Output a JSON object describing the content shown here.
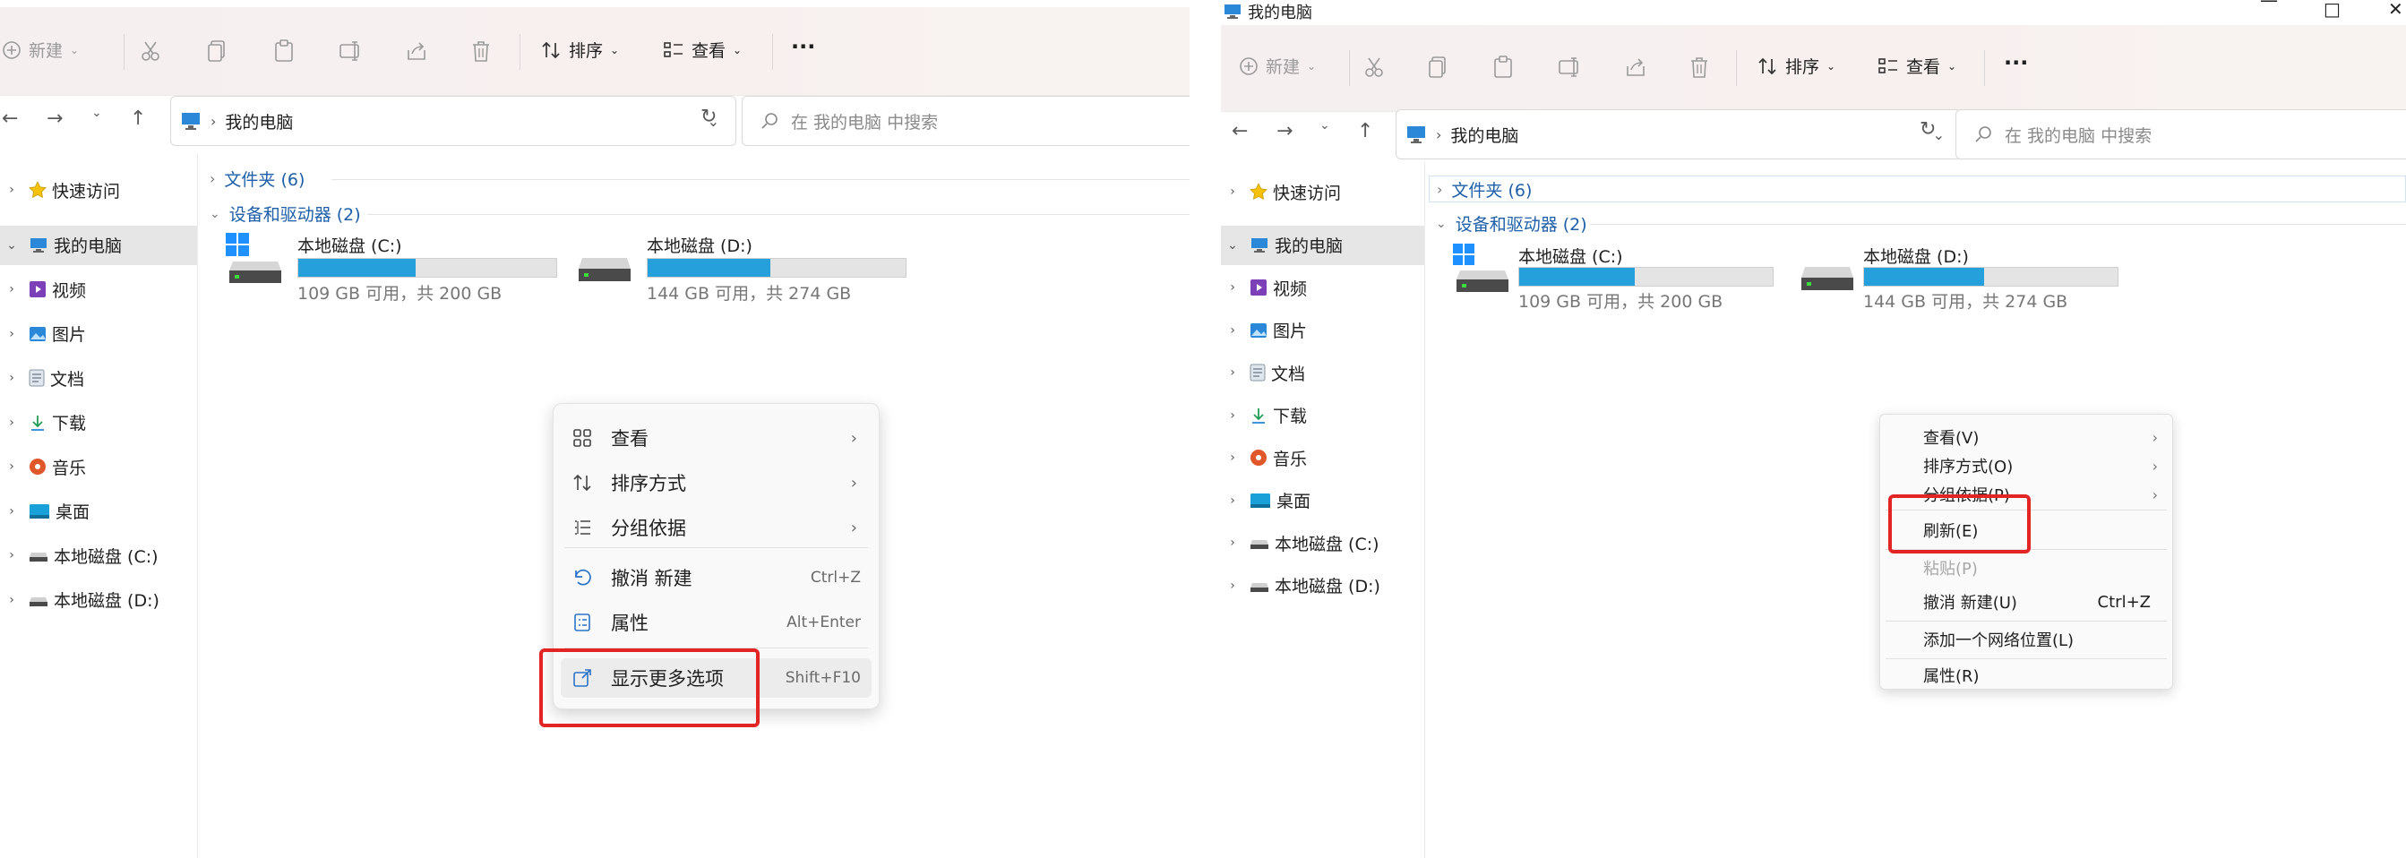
{
  "left": {
    "toolbar": {
      "new_label": "新建",
      "sort_label": "排序",
      "view_label": "查看",
      "more_label": "···"
    },
    "address": {
      "path": "我的电脑",
      "separator": "›"
    },
    "search": {
      "placeholder": "在 我的电脑 中搜索"
    },
    "sidebar": [
      {
        "label": "快速访问",
        "icon": "star-icon"
      },
      {
        "label": "我的电脑",
        "icon": "computer-icon",
        "selected": true
      },
      {
        "label": "视频",
        "icon": "video-icon"
      },
      {
        "label": "图片",
        "icon": "picture-icon"
      },
      {
        "label": "文档",
        "icon": "document-icon"
      },
      {
        "label": "下载",
        "icon": "download-icon"
      },
      {
        "label": "音乐",
        "icon": "music-icon"
      },
      {
        "label": "桌面",
        "icon": "desktop-icon"
      },
      {
        "label": "本地磁盘 (C:)",
        "icon": "drive-icon"
      },
      {
        "label": "本地磁盘 (D:)",
        "icon": "drive-icon"
      }
    ],
    "groups": {
      "folders": "文件夹 (6)",
      "devices": "设备和驱动器 (2)"
    },
    "drives": [
      {
        "name": "本地磁盘 (C:)",
        "free": "109 GB 可用，共 200 GB",
        "used_fraction": 0.455
      },
      {
        "name": "本地磁盘 (D:)",
        "free": "144 GB 可用，共 274 GB",
        "used_fraction": 0.474
      }
    ],
    "context_menu": {
      "items": [
        {
          "label": "查看",
          "icon": "grid-icon",
          "submenu": true
        },
        {
          "label": "排序方式",
          "icon": "sort-icon",
          "submenu": true
        },
        {
          "label": "分组依据",
          "icon": "group-icon",
          "submenu": true
        },
        {
          "label": "撤消 新建",
          "icon": "undo-icon",
          "shortcut": "Ctrl+Z"
        },
        {
          "label": "属性",
          "icon": "properties-icon",
          "shortcut": "Alt+Enter"
        },
        {
          "label": "显示更多选项",
          "icon": "more-options-icon",
          "shortcut": "Shift+F10"
        }
      ]
    }
  },
  "right": {
    "window_title": "我的电脑",
    "window_controls": {
      "minimize": "—",
      "maximize": "□",
      "close": "✕"
    },
    "toolbar": {
      "new_label": "新建",
      "sort_label": "排序",
      "view_label": "查看",
      "more_label": "···"
    },
    "address": {
      "path": "我的电脑",
      "separator": "›"
    },
    "search": {
      "placeholder": "在 我的电脑 中搜索"
    },
    "sidebar": [
      {
        "label": "快速访问",
        "icon": "star-icon"
      },
      {
        "label": "我的电脑",
        "icon": "computer-icon",
        "selected": true
      },
      {
        "label": "视频",
        "icon": "video-icon"
      },
      {
        "label": "图片",
        "icon": "picture-icon"
      },
      {
        "label": "文档",
        "icon": "document-icon"
      },
      {
        "label": "下载",
        "icon": "download-icon"
      },
      {
        "label": "音乐",
        "icon": "music-icon"
      },
      {
        "label": "桌面",
        "icon": "desktop-icon"
      },
      {
        "label": "本地磁盘 (C:)",
        "icon": "drive-icon"
      },
      {
        "label": "本地磁盘 (D:)",
        "icon": "drive-icon"
      }
    ],
    "groups": {
      "folders": "文件夹 (6)",
      "devices": "设备和驱动器 (2)"
    },
    "drives": [
      {
        "name": "本地磁盘 (C:)",
        "free": "109 GB 可用，共 200 GB",
        "used_fraction": 0.455
      },
      {
        "name": "本地磁盘 (D:)",
        "free": "144 GB 可用，共 274 GB",
        "used_fraction": 0.474
      }
    ],
    "classic_menu": {
      "items": [
        {
          "label": "查看(V)",
          "submenu": true
        },
        {
          "label": "排序方式(O)",
          "submenu": true
        },
        {
          "label": "分组依据(P)",
          "submenu": true
        },
        {
          "label": "刷新(E)"
        },
        {
          "label": "粘贴(P)",
          "disabled": true
        },
        {
          "label": "撤消 新建(U)",
          "shortcut": "Ctrl+Z"
        },
        {
          "label": "添加一个网络位置(L)"
        },
        {
          "label": "属性(R)"
        }
      ]
    }
  },
  "colors": {
    "accent": "#26a0da",
    "highlight": "#e32424",
    "link": "#1d5fa8"
  }
}
